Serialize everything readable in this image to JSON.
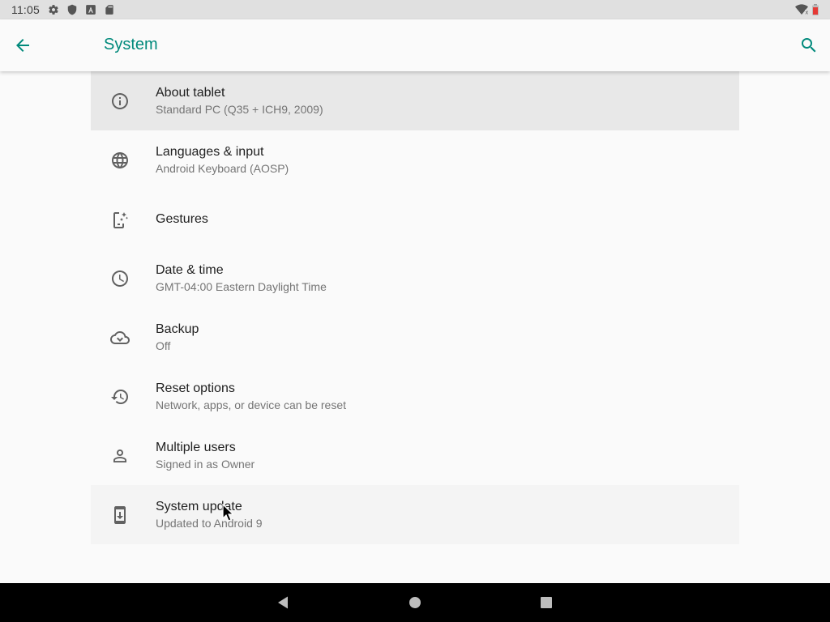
{
  "status_bar": {
    "time": "11:05",
    "left_icons": [
      "gear-icon",
      "shield-icon",
      "a-letter-icon",
      "sd-card-icon"
    ],
    "right_icons": [
      "wifi-icon",
      "battery-icon"
    ]
  },
  "app_bar": {
    "title": "System",
    "back_icon": "arrow-back-icon",
    "search_icon": "search-icon",
    "accent_color": "#00897b"
  },
  "settings": {
    "items": [
      {
        "title": "About tablet",
        "summary": "Standard PC (Q35 + ICH9, 2009)",
        "icon": "info-icon"
      },
      {
        "title": "Languages & input",
        "summary": "Android Keyboard (AOSP)",
        "icon": "globe-icon"
      },
      {
        "title": "Gestures",
        "summary": "",
        "icon": "gestures-icon"
      },
      {
        "title": "Date & time",
        "summary": "GMT-04:00 Eastern Daylight Time",
        "icon": "clock-icon"
      },
      {
        "title": "Backup",
        "summary": "Off",
        "icon": "cloud-backup-icon"
      },
      {
        "title": "Reset options",
        "summary": "Network, apps, or device can be reset",
        "icon": "reset-history-icon"
      },
      {
        "title": "Multiple users",
        "summary": "Signed in as Owner",
        "icon": "person-icon"
      },
      {
        "title": "System update",
        "summary": "Updated to Android 9",
        "icon": "system-update-icon"
      }
    ]
  },
  "nav_bar": {
    "buttons": [
      "nav-back-icon",
      "nav-home-icon",
      "nav-recents-icon"
    ]
  }
}
